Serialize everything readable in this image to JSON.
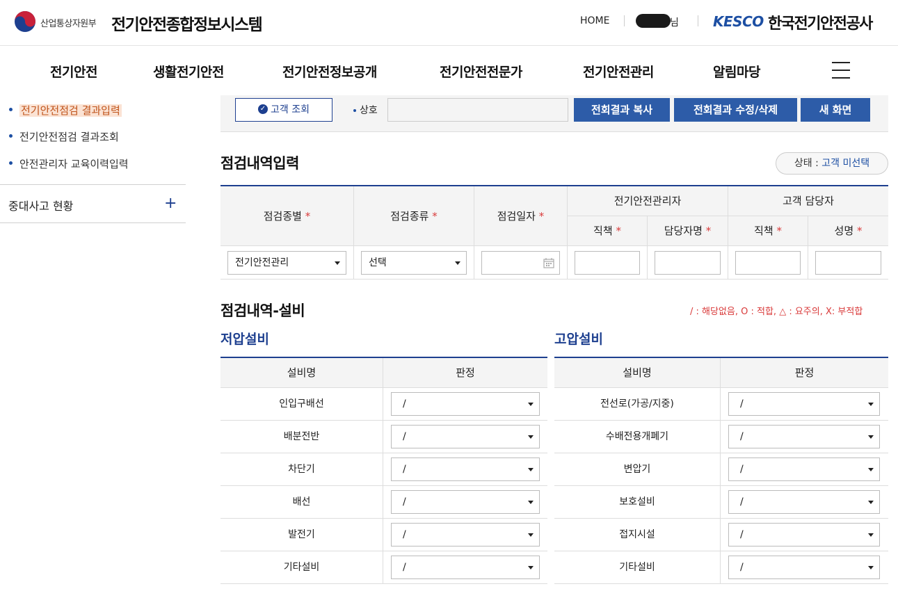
{
  "header": {
    "ministry": "산업통상자원부",
    "system_title": "전기안전종합정보시스템",
    "home": "HOME",
    "user_suffix": "님",
    "kesco_logo": "KESCO",
    "kesco_name": "한국전기안전공사"
  },
  "gnb": [
    "전기안전",
    "생활전기안전",
    "전기안전정보공개",
    "전기안전전문가",
    "전기안전관리",
    "알림마당"
  ],
  "sidebar": {
    "sub_items": [
      "전기안전점검 결과입력",
      "전기안전점검 결과조회",
      "안전관리자 교육이력입력"
    ],
    "main_item": "중대사고 현황",
    "plus": "+"
  },
  "search": {
    "customer_button": "고객 조회",
    "company_label": "상호",
    "company_value": "",
    "btn_copy": "전회결과 복사",
    "btn_edit": "전회결과 수정/삭제",
    "btn_new": "새 화면"
  },
  "inspection": {
    "title": "점검내역입력",
    "status_label": "상태 : ",
    "status_value": "고객 미선택",
    "headers": {
      "type": "점검종별",
      "kind": "점검종류",
      "date": "점검일자",
      "manager_group": "전기안전관리자",
      "customer_group": "고객 담당자",
      "position": "직책",
      "manager_name": "담당자명",
      "customer_position": "직책",
      "customer_name": "성명",
      "required": "*"
    },
    "type_value": "전기안전관리",
    "kind_value": "선택"
  },
  "equipment": {
    "title": "점검내역-설비",
    "legend": "/ : 해당없음, O : 적합, △ : 요주의, X: 부적합",
    "low": {
      "title": "저압설비",
      "col_name": "설비명",
      "col_judge": "판정",
      "rows": [
        {
          "name": "인입구배선",
          "value": "/"
        },
        {
          "name": "배분전반",
          "value": "/"
        },
        {
          "name": "차단기",
          "value": "/"
        },
        {
          "name": "배선",
          "value": "/"
        },
        {
          "name": "발전기",
          "value": "/"
        },
        {
          "name": "기타설비",
          "value": "/"
        }
      ]
    },
    "high": {
      "title": "고압설비",
      "col_name": "설비명",
      "col_judge": "판정",
      "rows": [
        {
          "name": "전선로(가공/지중)",
          "value": "/"
        },
        {
          "name": "수배전용개폐기",
          "value": "/"
        },
        {
          "name": "변압기",
          "value": "/"
        },
        {
          "name": "보호설비",
          "value": "/"
        },
        {
          "name": "접지시설",
          "value": "/"
        },
        {
          "name": "기타설비",
          "value": "/"
        }
      ]
    }
  },
  "colors": {
    "primary": "#1d3f8f",
    "button": "#2d5ca8",
    "required": "#d93a3a",
    "active_menu": "#c0551d"
  }
}
